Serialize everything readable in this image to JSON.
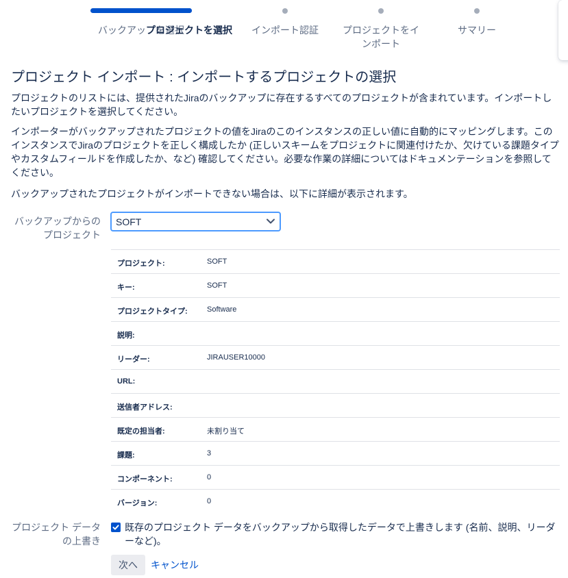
{
  "tracker": {
    "steps": [
      {
        "label": "バックアップを選択",
        "state": "completed"
      },
      {
        "label": "プロジェクトを選択",
        "state": "current"
      },
      {
        "label": "インポート認証",
        "state": "pending"
      },
      {
        "label": "プロジェクトをインポート",
        "state": "pending"
      },
      {
        "label": "サマリー",
        "state": "pending"
      }
    ]
  },
  "page": {
    "title": "プロジェクト インポート : インポートするプロジェクトの選択",
    "paragraphs": [
      "プロジェクトのリストには、提供されたJiraのバックアップに存在するすべてのプロジェクトが含まれています。インポートしたいプロジェクトを選択してください。",
      "インポーターがバックアップされたプロジェクトの値をJiraのこのインスタンスの正しい値に自動的にマッピングします。このインスタンスでJiraのプロジェクトを正しく構成したか (正しいスキームをプロジェクトに関連付けたか、欠けている課題タイプやカスタムフィールドを作成したか、など) 確認してください。必要な作業の詳細についてはドキュメンテーションを参照してください。",
      "バックアップされたプロジェクトがインポートできない場合は、以下に詳細が表示されます。"
    ]
  },
  "project_select": {
    "label": "バックアップからのプロジェクト",
    "value": "SOFT"
  },
  "details": [
    {
      "key": "プロジェクト:",
      "value": "SOFT"
    },
    {
      "key": "キー:",
      "value": "SOFT"
    },
    {
      "key": "プロジェクトタイプ:",
      "value": "Software"
    },
    {
      "key": "説明:",
      "value": ""
    },
    {
      "key": "リーダー:",
      "value": "JIRAUSER10000"
    },
    {
      "key": "URL:",
      "value": ""
    },
    {
      "key": "送信者アドレス:",
      "value": ""
    },
    {
      "key": "既定の担当者:",
      "value": "未割り当て"
    },
    {
      "key": "課題:",
      "value": "3"
    },
    {
      "key": "コンポーネント:",
      "value": "0"
    },
    {
      "key": "バージョン:",
      "value": "0"
    }
  ],
  "overwrite": {
    "label": "プロジェクト データの上書き",
    "checked": true,
    "text": "既存のプロジェクト データをバックアップから取得したデータで上書きします (名前、説明、リーダーなど)。"
  },
  "actions": {
    "next_label": "次へ",
    "cancel_label": "キャンセル"
  },
  "colors": {
    "accent": "#0052cc",
    "focus": "#4c9aff",
    "muted_text": "#5e6c84",
    "text": "#172b4d"
  }
}
